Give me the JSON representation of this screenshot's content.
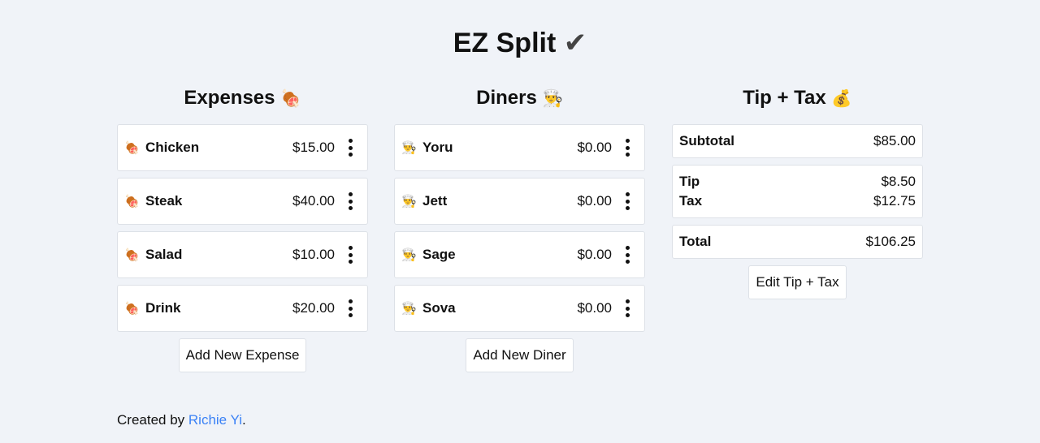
{
  "app": {
    "title": "EZ Split",
    "title_icon": "✔"
  },
  "expenses": {
    "heading": "Expenses",
    "heading_icon": "🍖",
    "items": [
      {
        "icon": "🍖",
        "name": "Chicken",
        "amount": "$15.00"
      },
      {
        "icon": "🍖",
        "name": "Steak",
        "amount": "$40.00"
      },
      {
        "icon": "🍖",
        "name": "Salad",
        "amount": "$10.00"
      },
      {
        "icon": "🍖",
        "name": "Drink",
        "amount": "$20.00"
      }
    ],
    "add_label": "Add New Expense"
  },
  "diners": {
    "heading": "Diners",
    "heading_icon": "👨‍🍳",
    "items": [
      {
        "icon": "👨‍🍳",
        "name": "Yoru",
        "amount": "$0.00"
      },
      {
        "icon": "👨‍🍳",
        "name": "Jett",
        "amount": "$0.00"
      },
      {
        "icon": "👨‍🍳",
        "name": "Sage",
        "amount": "$0.00"
      },
      {
        "icon": "👨‍🍳",
        "name": "Sova",
        "amount": "$0.00"
      }
    ],
    "add_label": "Add New Diner"
  },
  "tiptax": {
    "heading": "Tip + Tax",
    "heading_icon": "💰",
    "subtotal_label": "Subtotal",
    "subtotal_value": "$85.00",
    "tip_label": "Tip",
    "tip_value": "$8.50",
    "tax_label": "Tax",
    "tax_value": "$12.75",
    "total_label": "Total",
    "total_value": "$106.25",
    "edit_label": "Edit Tip + Tax"
  },
  "footer": {
    "prefix": "Created by ",
    "author": "Richie Yi",
    "suffix": "."
  },
  "colors": {
    "background": "#f0f3f8",
    "link": "#3b82f6",
    "card_border": "#dde1e7"
  }
}
